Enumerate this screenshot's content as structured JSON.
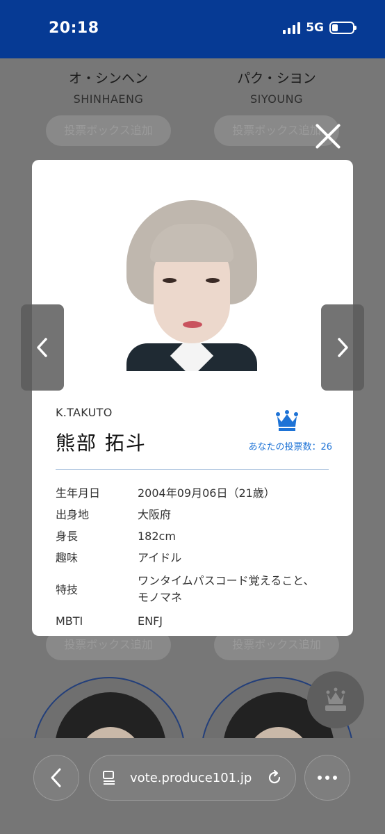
{
  "status_bar": {
    "time": "20:18",
    "network": "5G"
  },
  "background": {
    "cards": [
      {
        "name_jp": "オ・シンヘン",
        "name_en": "SHINHAENG"
      },
      {
        "name_jp": "パク・シヨン",
        "name_en": "SIYOUNG"
      }
    ],
    "vote_button_label": "投票ボックス追加"
  },
  "profile": {
    "name_en": "K.TAKUTO",
    "name_jp": "熊部 拓斗",
    "vote_count_label": "あなたの投票数：26",
    "details": [
      {
        "key": "生年月日",
        "value": "2004年09月06日（21歳）"
      },
      {
        "key": "出身地",
        "value": "大阪府"
      },
      {
        "key": "身長",
        "value": "182cm"
      },
      {
        "key": "趣味",
        "value": "アイドル"
      },
      {
        "key": "特技",
        "value": "ワンタイムパスコード覚えること、",
        "value2": "モノマネ"
      },
      {
        "key": "MBTI",
        "value": "ENFJ"
      }
    ]
  },
  "icons": {
    "close": "close-icon",
    "prev": "chevron-left-icon",
    "next": "chevron-right-icon",
    "crown": "crown-icon",
    "back": "chevron-left-icon",
    "tabs": "tab-list-icon",
    "reload": "reload-icon",
    "more": "ellipsis-icon"
  },
  "colors": {
    "status_bar": "#063a94",
    "accent_blue": "#1e73d6"
  },
  "browser": {
    "url": "vote.produce101.jp"
  }
}
